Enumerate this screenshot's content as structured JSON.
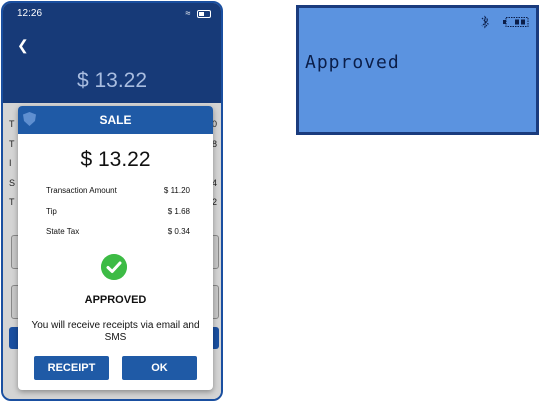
{
  "phone": {
    "status": {
      "time": "12:26"
    },
    "header": {
      "amount": "$ 13.22"
    },
    "background_rows": [
      {
        "label": "T",
        "value": "0"
      },
      {
        "label": "T",
        "value": "8"
      },
      {
        "label": "I",
        "value": ""
      },
      {
        "label": "S",
        "value": "4"
      },
      {
        "label": "T",
        "value": "2"
      }
    ]
  },
  "modal": {
    "title": "SALE",
    "amount": "$ 13.22",
    "details": [
      {
        "label": "Transaction Amount",
        "value": "$ 11.20"
      },
      {
        "label": "Tip",
        "value": "$ 1.68"
      },
      {
        "label": "State Tax",
        "value": "$ 0.34"
      }
    ],
    "status": "APPROVED",
    "message": "You will receive receipts via email and SMS",
    "buttons": {
      "receipt": "RECEIPT",
      "ok": "OK"
    }
  },
  "terminal": {
    "display_text": "Approved"
  },
  "colors": {
    "brand_blue": "#1f5aa6",
    "header_navy": "#173a78",
    "success_green": "#3dbb45",
    "lcd_blue": "#5b93e0"
  }
}
